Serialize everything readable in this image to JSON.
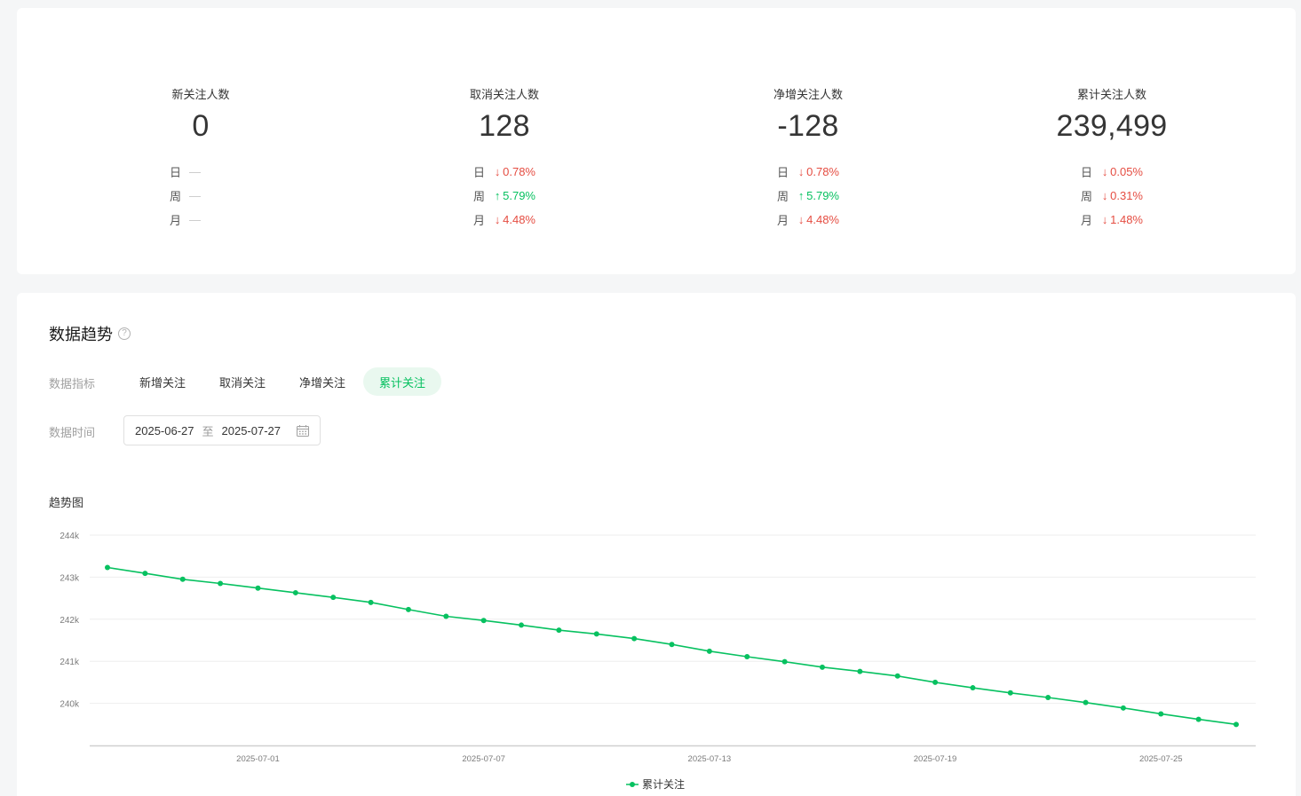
{
  "stats": [
    {
      "title": "新关注人数",
      "value": "0",
      "rows": [
        {
          "label": "日",
          "dir": "none",
          "value": "—"
        },
        {
          "label": "周",
          "dir": "none",
          "value": "—"
        },
        {
          "label": "月",
          "dir": "none",
          "value": "—"
        }
      ]
    },
    {
      "title": "取消关注人数",
      "value": "128",
      "rows": [
        {
          "label": "日",
          "dir": "down",
          "value": "0.78%"
        },
        {
          "label": "周",
          "dir": "up",
          "value": "5.79%"
        },
        {
          "label": "月",
          "dir": "down",
          "value": "4.48%"
        }
      ]
    },
    {
      "title": "净增关注人数",
      "value": "-128",
      "rows": [
        {
          "label": "日",
          "dir": "down",
          "value": "0.78%"
        },
        {
          "label": "周",
          "dir": "up",
          "value": "5.79%"
        },
        {
          "label": "月",
          "dir": "down",
          "value": "4.48%"
        }
      ]
    },
    {
      "title": "累计关注人数",
      "value": "239,499",
      "rows": [
        {
          "label": "日",
          "dir": "down",
          "value": "0.05%"
        },
        {
          "label": "周",
          "dir": "down",
          "value": "0.31%"
        },
        {
          "label": "月",
          "dir": "down",
          "value": "1.48%"
        }
      ]
    }
  ],
  "trend": {
    "title": "数据趋势",
    "help_icon": "question-circle-icon",
    "metric_label": "数据指标",
    "metrics": [
      "新增关注",
      "取消关注",
      "净增关注",
      "累计关注"
    ],
    "active_metric": 3,
    "time_label": "数据时间",
    "date_start": "2025-06-27",
    "date_sep": "至",
    "date_end": "2025-07-27",
    "calendar_icon": "calendar-icon",
    "chart_title": "趋势图"
  },
  "colors": {
    "accent": "#07c160",
    "down": "#e54d42",
    "up": "#07c160"
  },
  "chart_data": {
    "type": "line",
    "x": [
      "2025-06-27",
      "2025-06-28",
      "2025-06-29",
      "2025-06-30",
      "2025-07-01",
      "2025-07-02",
      "2025-07-03",
      "2025-07-04",
      "2025-07-05",
      "2025-07-06",
      "2025-07-07",
      "2025-07-08",
      "2025-07-09",
      "2025-07-10",
      "2025-07-11",
      "2025-07-12",
      "2025-07-13",
      "2025-07-14",
      "2025-07-15",
      "2025-07-16",
      "2025-07-17",
      "2025-07-18",
      "2025-07-19",
      "2025-07-20",
      "2025-07-21",
      "2025-07-22",
      "2025-07-23",
      "2025-07-24",
      "2025-07-25",
      "2025-07-26",
      "2025-07-27"
    ],
    "x_ticks": [
      "2025-07-01",
      "2025-07-07",
      "2025-07-13",
      "2025-07-19",
      "2025-07-25"
    ],
    "series": [
      {
        "name": "累计关注",
        "color": "#07c160",
        "values": [
          243230,
          243090,
          242950,
          242850,
          242740,
          242630,
          242520,
          242400,
          242230,
          242070,
          241970,
          241860,
          241740,
          241650,
          241540,
          241400,
          241240,
          241110,
          240990,
          240860,
          240760,
          240650,
          240500,
          240370,
          240250,
          240140,
          240020,
          239890,
          239750,
          239620,
          239499
        ]
      }
    ],
    "y_ticks": [
      240000,
      241000,
      242000,
      243000,
      244000
    ],
    "y_tick_labels": [
      "240k",
      "241k",
      "242k",
      "243k",
      "244k"
    ],
    "ylim": [
      239000,
      244000
    ],
    "grid": true,
    "legend_position": "bottom-center"
  }
}
